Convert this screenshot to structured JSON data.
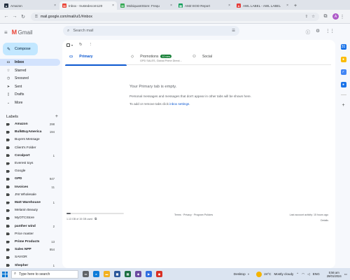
{
  "browser": {
    "tabs": [
      {
        "title": "Amazon",
        "fav_color": "#232f3e",
        "fav_letter": "a",
        "active": false
      },
      {
        "title": "Inbox - trustedecom120",
        "fav_color": "#ea4335",
        "fav_letter": "M",
        "active": true
      },
      {
        "title": "MobiquantStore: Frequ",
        "fav_color": "#34a853",
        "fav_letter": "M",
        "active": false
      },
      {
        "title": "AMZ EOD Report",
        "fav_color": "#0f9d58",
        "fav_letter": "▤",
        "active": false
      },
      {
        "title": "AWL LABEL - AWL LABEL",
        "fav_color": "#e53935",
        "fav_letter": "A",
        "active": false
      }
    ],
    "url": "mail.google.com/mail/u/1/#inbox",
    "profile_letter": "A",
    "accent": "#ad5ac8"
  },
  "gmail": {
    "product_name": "Gmail",
    "search_placeholder": "Search mail",
    "compose_label": "Compose"
  },
  "nav": [
    {
      "label": "Inbox",
      "icon": "inbox-icon",
      "glyph": "▭",
      "active": true
    },
    {
      "label": "Starred",
      "icon": "star-icon",
      "glyph": "☆",
      "active": false
    },
    {
      "label": "Snoozed",
      "icon": "clock-icon",
      "glyph": "◷",
      "active": false
    },
    {
      "label": "Sent",
      "icon": "send-icon",
      "glyph": "➤",
      "active": false
    },
    {
      "label": "Drafts",
      "icon": "draft-icon",
      "glyph": "▯",
      "active": false
    },
    {
      "label": "More",
      "icon": "chevron-down-icon",
      "glyph": "⌄",
      "active": false
    }
  ],
  "labels_heading": "Labels",
  "labels": [
    {
      "name": "Amazon",
      "count": "298",
      "bold": true
    },
    {
      "name": "BulkBuyAmerica",
      "count": "194",
      "bold": true
    },
    {
      "name": "Buyers Message",
      "count": "",
      "bold": false
    },
    {
      "name": "Client's Folder",
      "count": "",
      "bold": false
    },
    {
      "name": "Coralport",
      "count": "1",
      "bold": true
    },
    {
      "name": "Everest toys",
      "count": "",
      "bold": false
    },
    {
      "name": "Google",
      "count": "",
      "bold": false
    },
    {
      "name": "GPD",
      "count": "947",
      "bold": true
    },
    {
      "name": "Invoices",
      "count": "11",
      "bold": true
    },
    {
      "name": "JNI Wholesale",
      "count": "",
      "bold": false
    },
    {
      "name": "Matt Warehouse",
      "count": "1",
      "bold": true
    },
    {
      "name": "Melanin Beauty",
      "count": "",
      "bold": false
    },
    {
      "name": "MyOTCStore",
      "count": "",
      "bold": false
    },
    {
      "name": "panther wind",
      "count": "2",
      "bold": true
    },
    {
      "name": "Price master",
      "count": "",
      "bold": false
    },
    {
      "name": "Prime Products",
      "count": "13",
      "bold": true
    },
    {
      "name": "Sales NPP",
      "count": "854",
      "bold": true
    },
    {
      "name": "SAVIOR",
      "count": "",
      "bold": false
    },
    {
      "name": "Shepher",
      "count": "1",
      "bold": true
    }
  ],
  "categories": [
    {
      "label": "Primary",
      "icon": "inbox-icon",
      "glyph": "▭",
      "active": true,
      "badge": "",
      "sub": ""
    },
    {
      "label": "Promotions",
      "icon": "tag-icon",
      "glyph": "◇",
      "active": false,
      "badge": "10 new",
      "sub": "GPD SALES, Global Prime Direct..."
    },
    {
      "label": "Social",
      "icon": "people-icon",
      "glyph": "⚇",
      "active": false,
      "badge": "",
      "sub": ""
    }
  ],
  "empty_state": {
    "line1": "Your Primary tab is empty.",
    "line2": "Personal messages and messages that don't appear in other tabs will be shown here.",
    "line3_prefix": "To add or remove tabs click ",
    "line3_link": "inbox settings",
    "line3_suffix": "."
  },
  "footer": {
    "storage_text": "1.13 GB of 15 GB used",
    "storage_fraction": 0.075,
    "links": "Terms · Privacy · Program Policies",
    "activity": "Last account activity: 15 hours ago",
    "details": "Details"
  },
  "taskbar": {
    "search_placeholder": "Type here to search",
    "desktop_label": "Desktop",
    "temperature": "24°C",
    "weather": "Mostly cloudy",
    "lang": "ENG",
    "time": "5:56 am",
    "date": "29/01/2024"
  }
}
